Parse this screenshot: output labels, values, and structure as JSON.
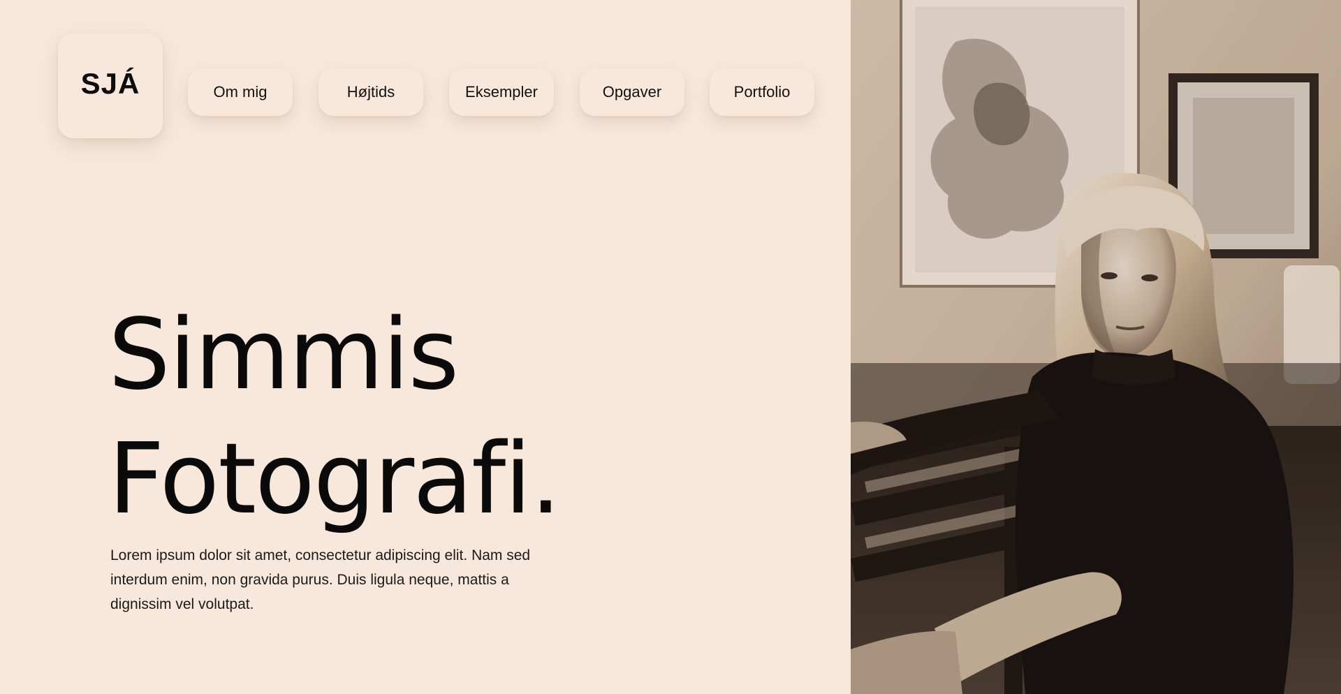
{
  "logo": {
    "text": "SJÁ"
  },
  "nav": {
    "items": [
      {
        "label": "Om mig"
      },
      {
        "label": "Højtids"
      },
      {
        "label": "Eksempler"
      },
      {
        "label": "Opgaver"
      },
      {
        "label": "Portfolio"
      }
    ]
  },
  "hero": {
    "title_line1": "Simmis",
    "title_line2": "Fotografi.",
    "text": "Lorem ipsum dolor sit amet, consectetur adipiscing elit. Nam sed interdum enim, non gravida purus. Duis ligula neque, mattis a dignissim vel volutpat."
  },
  "colors": {
    "background": "#f8e8db",
    "text": "#0a0a0a"
  },
  "photo": {
    "subject": "sepia-portrait"
  }
}
